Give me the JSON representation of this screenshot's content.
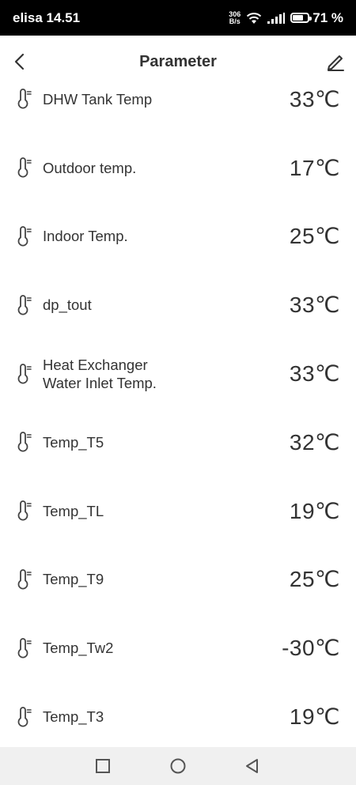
{
  "status_bar": {
    "carrier_time": "elisa 14.51",
    "net_speed_value": "306",
    "net_speed_unit": "B/s",
    "battery_percent": "71 %",
    "battery_level": 0.71
  },
  "header": {
    "title": "Parameter"
  },
  "parameters": [
    {
      "label": "DHW Tank Temp",
      "value": "33℃"
    },
    {
      "label": "Outdoor temp.",
      "value": "17℃"
    },
    {
      "label": "Indoor Temp.",
      "value": "25℃"
    },
    {
      "label": "dp_tout",
      "value": "33℃"
    },
    {
      "label": "Heat Exchanger\nWater Inlet Temp.",
      "value": "33℃"
    },
    {
      "label": "Temp_T5",
      "value": "32℃"
    },
    {
      "label": "Temp_TL",
      "value": "19℃"
    },
    {
      "label": "Temp_T9",
      "value": "25℃"
    },
    {
      "label": "Temp_Tw2",
      "value": "-30℃"
    },
    {
      "label": "Temp_T3",
      "value": "19℃"
    }
  ],
  "icons": {
    "back": "back-arrow-icon",
    "edit": "pencil-icon",
    "parameter": "thermometer-icon",
    "nav_recents": "square-icon",
    "nav_home": "circle-icon",
    "nav_back": "triangle-back-icon"
  }
}
